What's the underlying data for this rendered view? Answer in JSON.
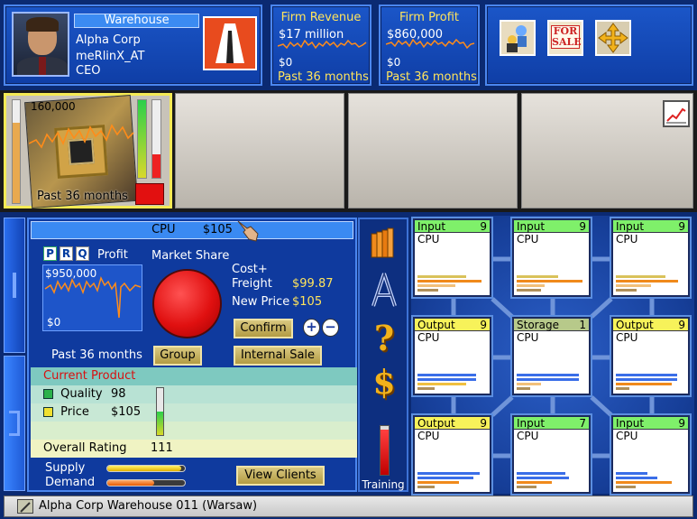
{
  "header": {
    "building_type": "Warehouse",
    "company": "Alpha Corp",
    "player": "meRlinX_AT",
    "title": "CEO",
    "revenue": {
      "label": "Firm Revenue",
      "value": "$17 million",
      "zero": "$0",
      "period": "Past 36 months"
    },
    "profit": {
      "label": "Firm Profit",
      "value": "$860,000",
      "zero": "$0",
      "period": "Past 36 months"
    },
    "tools": [
      "staff-icon",
      "for-sale-icon",
      "move-icon"
    ],
    "for_sale_text": "FOR SALE"
  },
  "slots": {
    "first": {
      "value": "160,000",
      "period": "Past 36 months"
    },
    "chart_button": "chart-icon"
  },
  "product_panel": {
    "product": "CPU",
    "price": "$105",
    "tabs": [
      "P",
      "R",
      "Q"
    ],
    "profit_label": "Profit",
    "profit_value": "$950,000",
    "profit_zero": "$0",
    "profit_period": "Past 36 months",
    "market_share_label": "Market Share",
    "cost_label": "Cost+",
    "freight_label": "Freight",
    "freight_value": "$99.87",
    "new_price_label": "New Price",
    "new_price_value": "$105",
    "confirm": "Confirm",
    "group": "Group",
    "internal_sale": "Internal Sale",
    "current_product": "Current Product",
    "quality_label": "Quality",
    "quality_value": "98",
    "price_label": "Price",
    "price_value": "$105",
    "overall_label": "Overall Rating",
    "overall_value": "111",
    "supply_label": "Supply",
    "demand_label": "Demand",
    "view_clients": "View Clients",
    "supply_level": 0.95,
    "demand_level": 0.6,
    "quality_level": 0.5,
    "price_level": 0.55
  },
  "side_tools": {
    "training": "Training"
  },
  "nodes": [
    {
      "type": "Input",
      "count": "9",
      "product": "CPU",
      "color": "#7ff06a"
    },
    {
      "type": "Input",
      "count": "9",
      "product": "CPU",
      "color": "#7ff06a"
    },
    {
      "type": "Input",
      "count": "9",
      "product": "CPU",
      "color": "#7ff06a"
    },
    {
      "type": "Output",
      "count": "9",
      "product": "CPU",
      "color": "#f7f25a"
    },
    {
      "type": "Storage",
      "count": "1",
      "product": "CPU",
      "color": "#b7c98a"
    },
    {
      "type": "Output",
      "count": "9",
      "product": "CPU",
      "color": "#f7f25a"
    },
    {
      "type": "Output",
      "count": "9",
      "product": "CPU",
      "color": "#f7f25a"
    },
    {
      "type": "Input",
      "count": "7",
      "product": "CPU",
      "color": "#7ff06a"
    },
    {
      "type": "Input",
      "count": "9",
      "product": "CPU",
      "color": "#7ff06a"
    }
  ],
  "status": {
    "text": "Alpha Corp Warehouse 011 (Warsaw)"
  }
}
